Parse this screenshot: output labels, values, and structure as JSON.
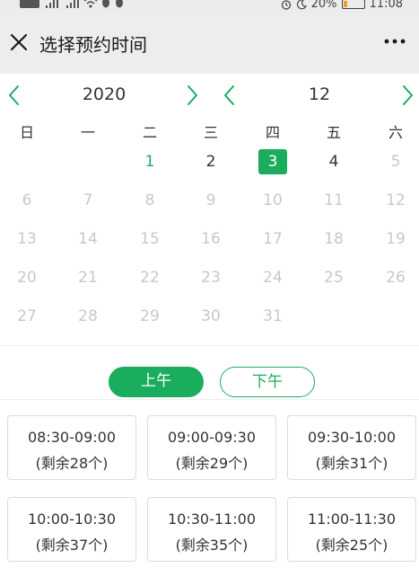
{
  "status_bar": {
    "battery_percent": "20%",
    "time": "11:08",
    "battery_level": 0.2
  },
  "header": {
    "title": "选择预约时间"
  },
  "calendar": {
    "year": "2020",
    "month": "12",
    "weekdays": [
      "日",
      "一",
      "二",
      "三",
      "四",
      "五",
      "六"
    ],
    "weeks": [
      [
        "",
        "",
        "1",
        "2",
        "3",
        "4",
        "5"
      ],
      [
        "6",
        "7",
        "8",
        "9",
        "10",
        "11",
        "12"
      ],
      [
        "13",
        "14",
        "15",
        "16",
        "17",
        "18",
        "19"
      ],
      [
        "20",
        "21",
        "22",
        "23",
        "24",
        "25",
        "26"
      ],
      [
        "27",
        "28",
        "29",
        "30",
        "31",
        "",
        ""
      ]
    ],
    "today_day": "1",
    "selected_day": "3",
    "available_days": [
      "2",
      "3",
      "4"
    ]
  },
  "period_tabs": {
    "am_label": "上午",
    "pm_label": "下午",
    "active": "am"
  },
  "slots": [
    {
      "time": "08:30-09:00",
      "remaining": "(剩余28个)"
    },
    {
      "time": "09:00-09:30",
      "remaining": "(剩余29个)"
    },
    {
      "time": "09:30-10:00",
      "remaining": "(剩余31个)"
    },
    {
      "time": "10:00-10:30",
      "remaining": "(剩余37个)"
    },
    {
      "time": "10:30-11:00",
      "remaining": "(剩余35个)"
    },
    {
      "time": "11:00-11:30",
      "remaining": "(剩余25个)"
    }
  ],
  "colors": {
    "accent": "#1aad5e",
    "disabled_text": "#c8c8c8",
    "header_bg": "#ededed"
  }
}
